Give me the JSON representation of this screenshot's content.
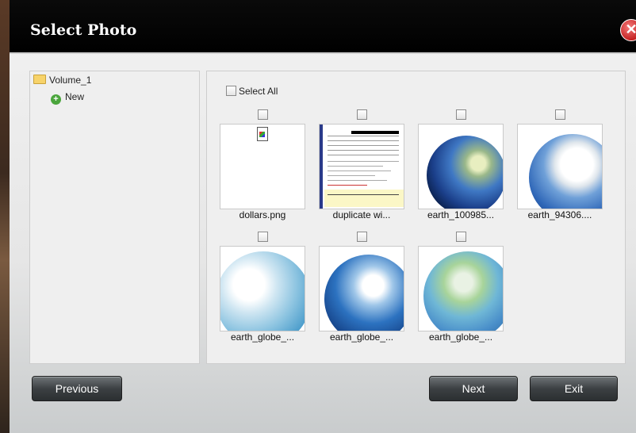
{
  "dialog": {
    "title": "Select Photo",
    "close_symbol": "✕"
  },
  "tree": {
    "root_label": "Volume_1",
    "new_label": "New",
    "new_symbol": "+"
  },
  "grid": {
    "select_all_label": "Select All",
    "items": [
      {
        "name": "dollars.png"
      },
      {
        "name": "duplicate wi..."
      },
      {
        "name": "earth_100985..."
      },
      {
        "name": "earth_94306...."
      },
      {
        "name": "earth_globe_..."
      },
      {
        "name": "earth_globe_..."
      },
      {
        "name": "earth_globe_..."
      }
    ]
  },
  "buttons": {
    "previous": "Previous",
    "next": "Next",
    "exit": "Exit"
  },
  "colors": {
    "title_bar": "#000000",
    "close": "#c42222",
    "button": "#3c4043"
  }
}
